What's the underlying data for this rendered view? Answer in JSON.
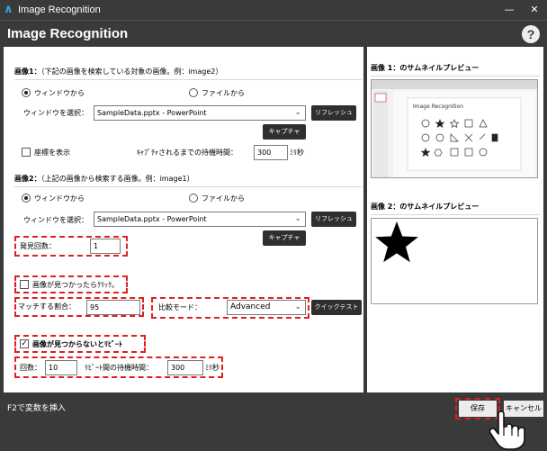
{
  "window": {
    "title": "Image Recognition",
    "minimize_glyph": "—",
    "close_glyph": "✕"
  },
  "header": {
    "title": "Image Recognition",
    "help_glyph": "?"
  },
  "image1": {
    "heading": "画像1：",
    "note": "（下記の画像を検索している対象の画像。例：image2）",
    "radio_window": "ウィンドウから",
    "radio_file": "ファイルから",
    "select_window_label": "ウィンドウを選択：",
    "select_value": "SampleData.pptx - PowerPoint",
    "refresh": "リフレッシュ",
    "capture": "キャプチャ",
    "show_coords": "座標を表示",
    "wait_label": "ｷｬﾌﾟﾁｬされるまでの待機時間：",
    "wait_value": "300",
    "wait_unit": "ﾐﾘ秒"
  },
  "image2": {
    "heading": "画像2：",
    "note": "（上記の画像から検索する画像。例：image1）",
    "radio_window": "ウィンドウから",
    "radio_file": "ファイルから",
    "select_window_label": "ウィンドウを選択：",
    "select_value": "SampleData.pptx - PowerPoint",
    "refresh": "リフレッシュ",
    "capture": "キャプチャ"
  },
  "options": {
    "found_count_label": "発見回数：",
    "found_count_value": "1",
    "click_if_found": "画像が見つかったらｸﾘｯｸ。",
    "match_rate_label": "マッチする割合：",
    "match_rate_value": "95",
    "compare_mode_label": "比較モード：",
    "compare_mode_value": "Advanced",
    "quick_test": "クイックテスト",
    "repeat_if_not_found": "画像が見つからないとﾘﾋﾟｰﾄ",
    "repeat_count_label": "回数：",
    "repeat_count_value": "10",
    "repeat_wait_label": "ﾘﾋﾟｰﾄ間の待機時間：",
    "repeat_wait_value": "300",
    "repeat_wait_unit": "ﾐﾘ秒"
  },
  "preview": {
    "thumb1_title": "画像 1：のサムネイルプレビュー",
    "thumb1_slide_text": "Image Recognition",
    "thumb2_title": "画像 2：のサムネイルプレビュー"
  },
  "footer": {
    "hint": "F2で変数を挿入",
    "save": "保存",
    "cancel": "キャンセル"
  },
  "icons": {
    "app_logo": "app-logo-icon",
    "help": "help-icon",
    "star": "star-icon",
    "cursor": "hand-cursor-icon"
  },
  "colors": {
    "chrome": "#3a3a3a",
    "highlight_dash": "#e02020",
    "button_dark": "#2f2f2f"
  }
}
